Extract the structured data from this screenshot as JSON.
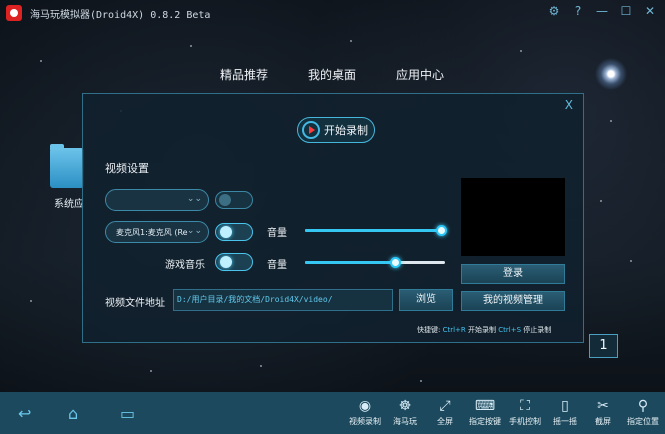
{
  "titlebar": {
    "title": "海马玩模拟器(Droid4X) 0.8.2 Beta"
  },
  "topnav": {
    "tabs": [
      "精品推荐",
      "我的桌面",
      "应用中心"
    ]
  },
  "desktop": {
    "icon_label": "系统应"
  },
  "dialog": {
    "record_button": "开始录制",
    "section_title": "视频设置",
    "mic_select": "麦克风1:麦克风 (Re",
    "mic_volume_label": "音量",
    "game_music_label": "游戏音乐",
    "music_volume_label": "音量",
    "mic_volume": 0.98,
    "music_volume": 0.65,
    "path_label": "视频文件地址",
    "path_value": "D:/用户目录/我的文档/Droid4X/video/",
    "browse_button": "浏览",
    "login_button": "登录",
    "my_videos_button": "我的视频管理",
    "hint_prefix": "快捷键:",
    "hint_key1": "Ctrl+R",
    "hint_action1": "开始录制",
    "hint_key2": "Ctrl+S",
    "hint_action2": "停止录制",
    "close_glyph": "X"
  },
  "page_number": "1",
  "bottombar": {
    "tools": [
      "视频录制",
      "海马玩",
      "全屏",
      "指定按键",
      "手机控制",
      "摇一摇",
      "截屏",
      "指定位置"
    ]
  }
}
